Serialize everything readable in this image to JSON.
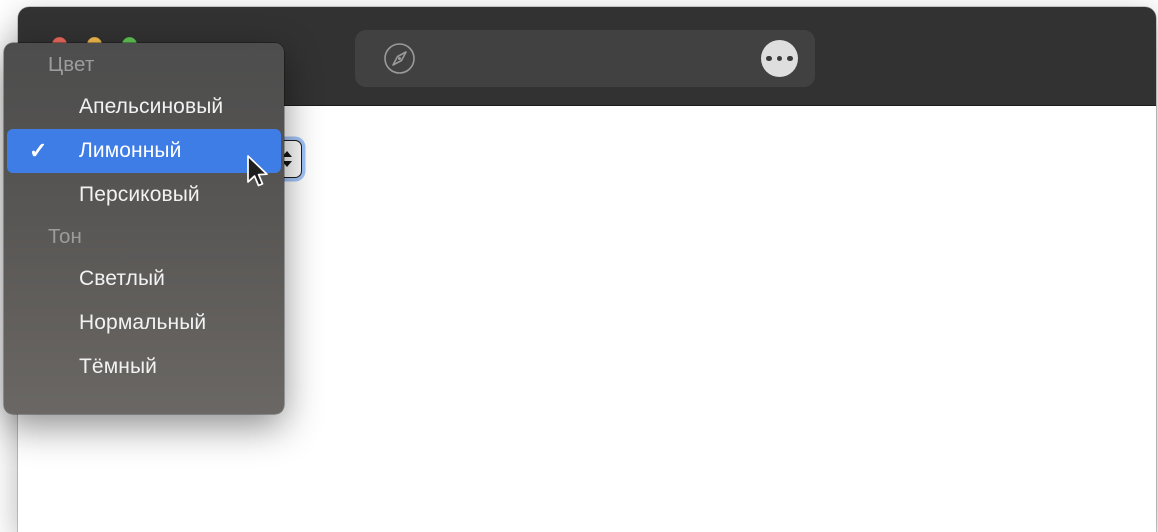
{
  "window": {
    "traffic_lights": [
      {
        "name": "close",
        "color": "#ec6a5f"
      },
      {
        "name": "minimize",
        "color": "#f4bd4f"
      },
      {
        "name": "zoom",
        "color": "#61c454"
      }
    ],
    "toolbar": {
      "address_value": "",
      "address_placeholder": "",
      "compass_icon": "compass-icon",
      "more_icon": "more-ellipsis-icon"
    }
  },
  "popup_button": {
    "value": "",
    "chevron_up_icon": "chevron-up-icon",
    "chevron_down_icon": "chevron-down-icon",
    "focused": true
  },
  "menu": {
    "sections": [
      {
        "title": "Цвет",
        "items": [
          {
            "label": "Апельсиновый",
            "selected": false
          },
          {
            "label": "Лимонный",
            "selected": true
          },
          {
            "label": "Персиковый",
            "selected": false
          }
        ]
      },
      {
        "title": "Тон",
        "items": [
          {
            "label": "Светлый",
            "selected": false
          },
          {
            "label": "Нормальный",
            "selected": false
          },
          {
            "label": "Тёмный",
            "selected": false
          }
        ]
      }
    ],
    "checkmark": "✓"
  },
  "colors": {
    "accent": "#3e7ce6",
    "titlebar": "#323232",
    "addressbar": "#414141",
    "menu_text": "#f2f2f2",
    "menu_section_text": "#9c9c9c",
    "page_background": "#ffffff"
  },
  "cursor": {
    "icon": "arrow-cursor"
  }
}
